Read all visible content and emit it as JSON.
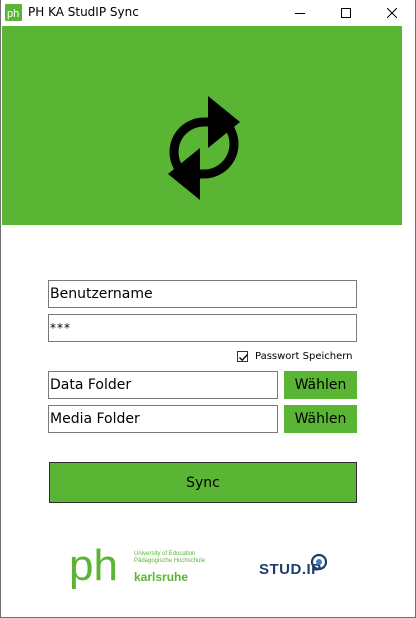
{
  "window": {
    "title": "PH KA StudIP Sync",
    "app_icon": "ph-logo-icon",
    "controls": [
      "minimize-icon",
      "maximize-icon",
      "close-icon"
    ]
  },
  "banner": {
    "icon": "sync-icon",
    "background_color": "#5ab535"
  },
  "form": {
    "username_value": "Benutzername",
    "password_value": "***",
    "save_password_label": "Passwort Speichern",
    "save_password_checked": true,
    "data_folder_value": "Data Folder",
    "data_folder_button": "Wählen",
    "media_folder_value": "Media Folder",
    "media_folder_button": "Wählen",
    "sync_button": "Sync"
  },
  "footer": {
    "ph_logo": {
      "mark": "ph",
      "tagline_line1": "University of Education",
      "tagline_line2": "Pädagogische Hochschule",
      "city": "karlsruhe"
    },
    "studip_logo": {
      "text": "STUD.IP"
    }
  },
  "colors": {
    "accent": "#5ab535",
    "border": "#7a7a7a",
    "studip_blue": "#1f3d6b"
  }
}
